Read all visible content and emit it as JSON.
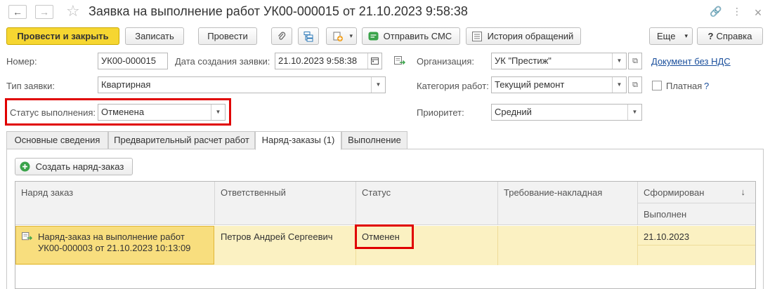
{
  "window": {
    "title": "Заявка на выполнение работ УК00-000015 от 21.10.2023 9:58:38",
    "back_glyph": "←",
    "forward_glyph": "→",
    "star_glyph": "☆",
    "link_glyph": "🔗",
    "menu_glyph": "⋮",
    "close_glyph": "×",
    "icons": [
      "back-arrow-icon",
      "forward-arrow-icon",
      "star-icon",
      "link-icon",
      "more-icon",
      "close-icon"
    ]
  },
  "toolbar": {
    "post_close": "Провести и закрыть",
    "save": "Записать",
    "post": "Провести",
    "send_sms": "Отправить СМС",
    "history": "История обращений",
    "more": "Еще",
    "help": "Справка",
    "help_glyph": "?",
    "dropdown_glyph": "▾"
  },
  "form": {
    "number_label": "Номер:",
    "number_value": "УК00-000015",
    "created_label": "Дата создания заявки:",
    "created_value": "21.10.2023  9:58:38",
    "org_label": "Организация:",
    "org_value": "УК \"Престиж\"",
    "doc_link": "Документ без НДС",
    "type_label": "Тип заявки:",
    "type_value": "Квартирная",
    "category_label": "Категория работ:",
    "category_value": "Текущий ремонт",
    "paid_label": "Платная",
    "paid_help": "?",
    "paid_checked": false,
    "status_label": "Статус выполнения:",
    "status_value": "Отменена",
    "priority_label": "Приоритет:",
    "priority_value": "Средний"
  },
  "tabs": [
    {
      "label": "Основные сведения",
      "active": false
    },
    {
      "label": "Предварительный расчет работ",
      "active": false
    },
    {
      "label": "Наряд-заказы (1)",
      "active": true
    },
    {
      "label": "Выполнение",
      "active": false
    }
  ],
  "orders": {
    "create_button": "Создать наряд-заказ",
    "headers": {
      "order": "Наряд заказ",
      "responsible": "Ответственный",
      "status": "Статус",
      "requisition": "Требование-накладная",
      "formed": "Сформирован",
      "done": "Выполнен",
      "sort_glyph": "↓"
    },
    "rows": [
      {
        "order_line1": "Наряд-заказ на выполнение работ",
        "order_line2": "УК00-000003 от 21.10.2023 10:13:09",
        "responsible": "Петров Андрей Сергеевич",
        "status": "Отменен",
        "requisition": "",
        "formed": "21.10.2023",
        "done": ""
      }
    ]
  },
  "colors": {
    "primary_button": "#f6d631",
    "highlight": "#e00000",
    "row_selected": "#fbf1c2",
    "link": "#1a4f9c"
  }
}
